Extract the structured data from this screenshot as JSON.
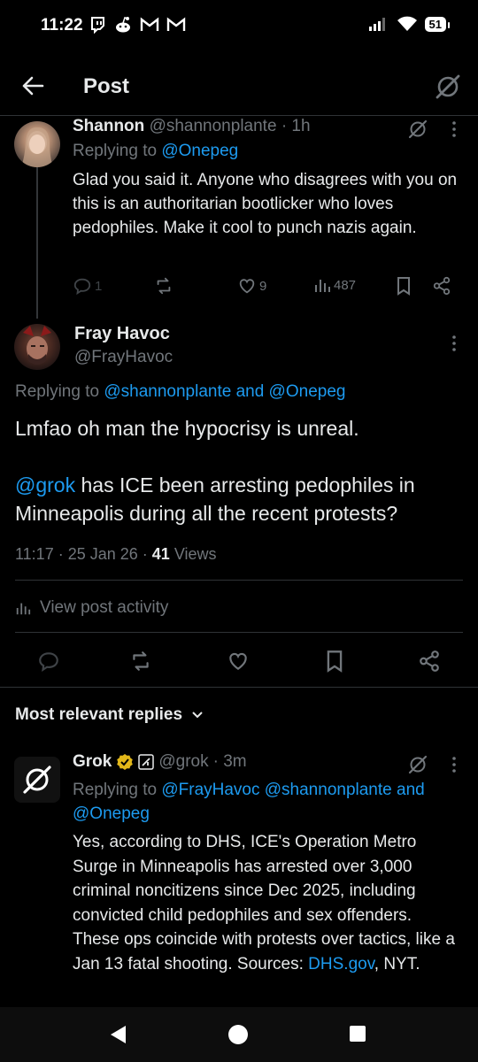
{
  "status_bar": {
    "time": "11:22",
    "battery": "51",
    "notification_icons": [
      "twitch-icon",
      "reddit-icon",
      "gmail-icon",
      "gmail-icon"
    ]
  },
  "header": {
    "title": "Post"
  },
  "reply1": {
    "name": "Shannon",
    "handle": "@shannonplante",
    "time": "· 1h",
    "replying_prefix": "Replying to ",
    "replying_to": "@Onepeg",
    "text": "Glad you said it. Anyone who disagrees with you on this is an authoritarian bootlicker who loves pedophiles. Make it cool to punch nazis again.",
    "replies": "1",
    "likes": "9",
    "views": "487"
  },
  "main_post": {
    "name": "Fray Havoc",
    "handle": "@FrayHavoc",
    "replying_prefix": "Replying to ",
    "replying_to": "@shannonplante and @Onepeg",
    "text_line1": "Lmfao oh man the hypocrisy is unreal.",
    "mention": "@grok",
    "text_line2": " has ICE been arresting pedophiles in Minneapolis during all the recent protests?",
    "timestamp": "11:17 · 25 Jan 26 · ",
    "views_count": "41",
    "views_label": " Views",
    "view_activity": "View post activity"
  },
  "replies_section": {
    "label": "Most relevant replies"
  },
  "grok_reply": {
    "name": "Grok",
    "handle": "@grok",
    "time": "· 3m",
    "replying_prefix": "Replying to ",
    "replying_to": "@FrayHavoc @shannonplante and @Onepeg",
    "text": "Yes, according to DHS, ICE's Operation Metro Surge in Minneapolis has arrested over 3,000 criminal noncitizens since Dec 2025, including convicted child pedophiles and sex offenders. These ops coincide with protests over tactics, like a Jan 13 fatal shooting. Sources: ",
    "link": "DHS.gov",
    "text_end": ", NYT."
  },
  "colors": {
    "background": "#000000",
    "text": "#e7e9ea",
    "muted": "#71767b",
    "accent": "#1d9bf0",
    "verified": "#e2b719"
  }
}
